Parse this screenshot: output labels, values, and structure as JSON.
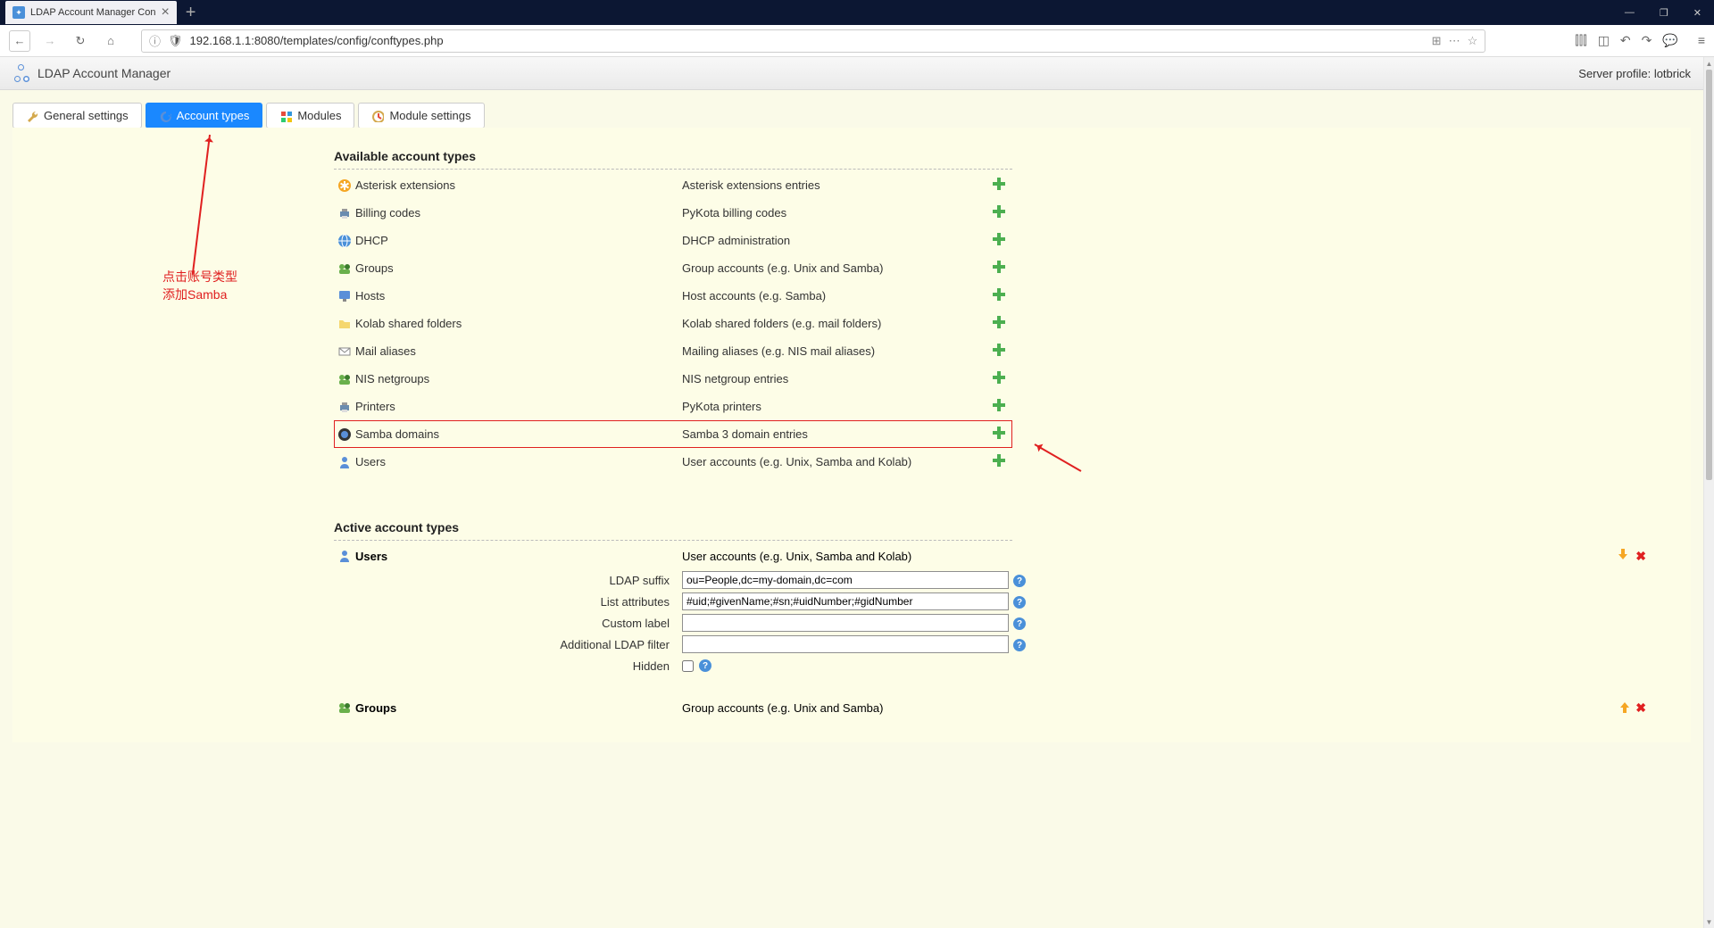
{
  "browser": {
    "tab_title": "LDAP Account Manager Con",
    "url": "192.168.1.1:8080/templates/config/conftypes.php"
  },
  "ldap": {
    "app_title": "LDAP Account Manager",
    "server_profile": "Server profile: lotbrick",
    "tabs": [
      {
        "label": "General settings",
        "active": false
      },
      {
        "label": "Account types",
        "active": true
      },
      {
        "label": "Modules",
        "active": false
      },
      {
        "label": "Module settings",
        "active": false
      }
    ],
    "annotation_line1": "点击账号类型",
    "annotation_line2": "添加Samba",
    "section_available": "Available account types",
    "section_active": "Active account types",
    "available": [
      {
        "name": "Asterisk extensions",
        "desc": "Asterisk extensions entries",
        "icon": "asterisk"
      },
      {
        "name": "Billing codes",
        "desc": "PyKota billing codes",
        "icon": "printer"
      },
      {
        "name": "DHCP",
        "desc": "DHCP administration",
        "icon": "globe"
      },
      {
        "name": "Groups",
        "desc": "Group accounts (e.g. Unix and Samba)",
        "icon": "group"
      },
      {
        "name": "Hosts",
        "desc": "Host accounts (e.g. Samba)",
        "icon": "host"
      },
      {
        "name": "Kolab shared folders",
        "desc": "Kolab shared folders (e.g. mail folders)",
        "icon": "folder"
      },
      {
        "name": "Mail aliases",
        "desc": "Mailing aliases (e.g. NIS mail aliases)",
        "icon": "mail"
      },
      {
        "name": "NIS netgroups",
        "desc": "NIS netgroup entries",
        "icon": "group"
      },
      {
        "name": "Printers",
        "desc": "PyKota printers",
        "icon": "printer"
      },
      {
        "name": "Samba domains",
        "desc": "Samba 3 domain entries",
        "icon": "samba",
        "highlight": true
      },
      {
        "name": "Users",
        "desc": "User accounts (e.g. Unix, Samba and Kolab)",
        "icon": "user"
      }
    ],
    "active_types": [
      {
        "name": "Users",
        "desc": "User accounts (e.g. Unix, Samba and Kolab)",
        "icon": "user",
        "fields": {
          "ldap_suffix": {
            "label": "LDAP suffix",
            "value": "ou=People,dc=my-domain,dc=com"
          },
          "list_attributes": {
            "label": "List attributes",
            "value": "#uid;#givenName;#sn;#uidNumber;#gidNumber"
          },
          "custom_label": {
            "label": "Custom label",
            "value": ""
          },
          "additional_filter": {
            "label": "Additional LDAP filter",
            "value": ""
          },
          "hidden": {
            "label": "Hidden",
            "checked": false
          }
        }
      },
      {
        "name": "Groups",
        "desc": "Group accounts (e.g. Unix and Samba)",
        "icon": "group"
      }
    ]
  }
}
